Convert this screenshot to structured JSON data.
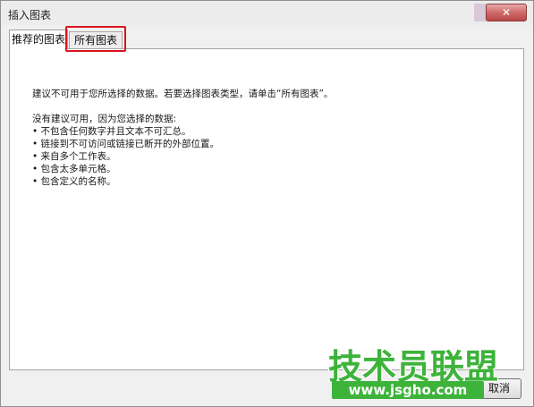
{
  "window": {
    "title": "插入图表",
    "close_label": "✕"
  },
  "tabs": [
    {
      "label": "推荐的图表",
      "active": true
    },
    {
      "label": "所有图表",
      "active": false,
      "highlighted": true
    }
  ],
  "content": {
    "hint": "建议不可用于您所选择的数据。若要选择图表类型，请单击“所有图表”。",
    "reason_heading": "没有建议可用，因为您选择的数据:",
    "reasons": [
      "• 不包含任何数字并且文本不可汇总。",
      "• 链接到不可访问或链接已断开的外部位置。",
      "• 来自多个工作表。",
      "• 包含太多单元格。",
      "• 包含定义的名称。"
    ]
  },
  "buttons": {
    "cancel_label": "取消"
  },
  "watermark": {
    "text": "技术员联盟",
    "url": "www.jsgho.com"
  },
  "colors": {
    "highlight": "#d9151b",
    "watermark_green": "#3db33a"
  }
}
